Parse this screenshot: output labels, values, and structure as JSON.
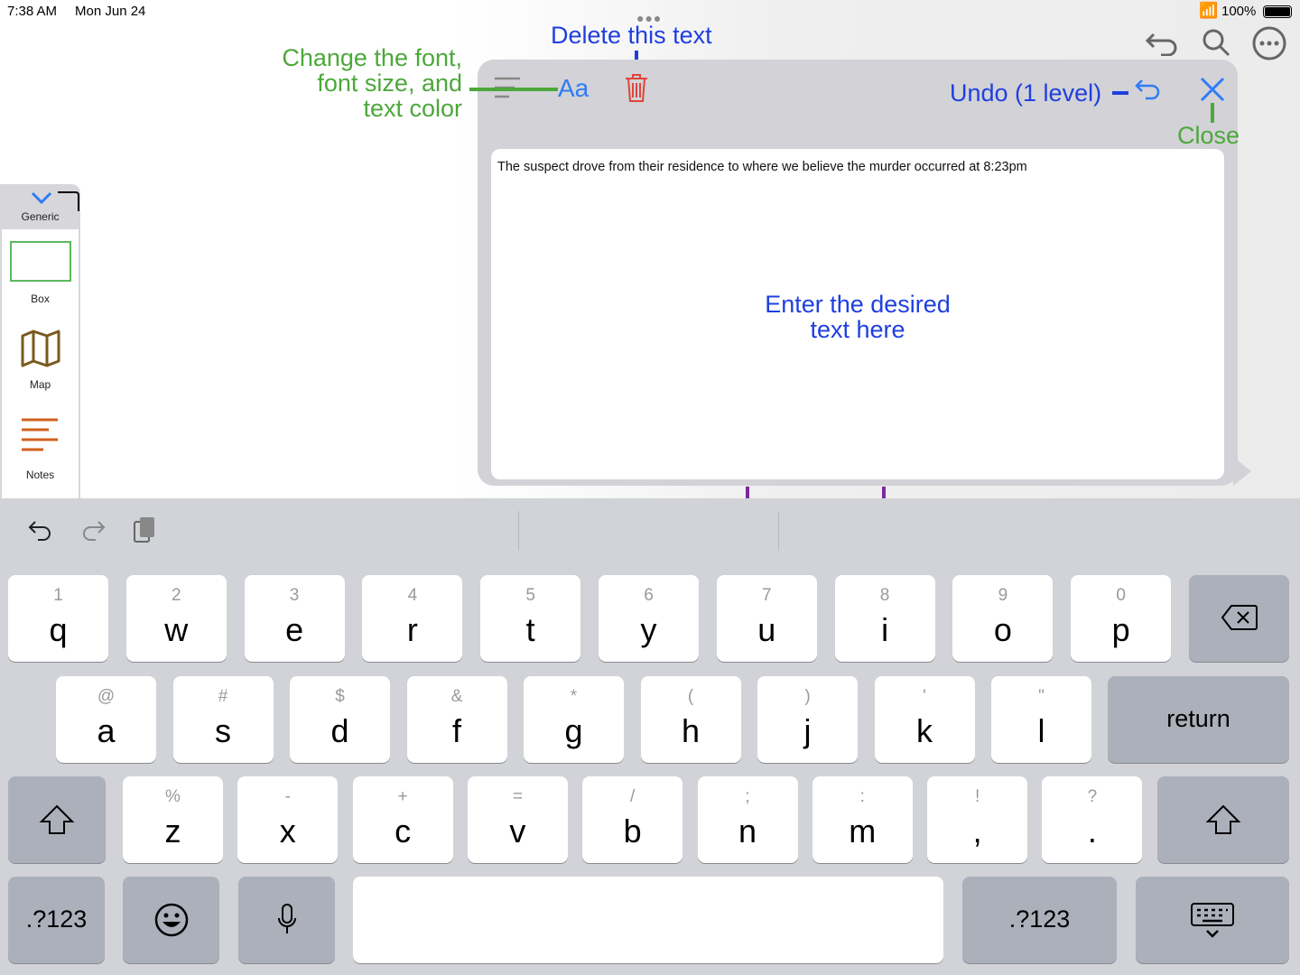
{
  "status_bar": {
    "time": "7:38 AM",
    "date": "Mon Jun 24",
    "battery": "100%"
  },
  "annotations": {
    "delete": "Delete this text",
    "font": [
      "Change the font,",
      "font size, and",
      "text color"
    ],
    "undo": "Undo (1 level)",
    "close": "Close",
    "enter": [
      "Enter the desired",
      "text here"
    ]
  },
  "toolbar": {
    "font_button": "Aa"
  },
  "editor": {
    "text": "The suspect drove from their residence to where we believe the murder occurred at 8:23pm"
  },
  "sidebar": {
    "header": "Generic",
    "items": [
      {
        "label": "Box"
      },
      {
        "label": "Map"
      },
      {
        "label": "Notes"
      }
    ]
  },
  "colors": {
    "annotation_blue": "#1f3fe0",
    "annotation_green": "#4ca83a",
    "accent": "#2f7cf6",
    "delete_red": "#e0453a"
  },
  "keyboard": {
    "row1": [
      {
        "p": "q",
        "s": "1"
      },
      {
        "p": "w",
        "s": "2"
      },
      {
        "p": "e",
        "s": "3"
      },
      {
        "p": "r",
        "s": "4"
      },
      {
        "p": "t",
        "s": "5"
      },
      {
        "p": "y",
        "s": "6"
      },
      {
        "p": "u",
        "s": "7"
      },
      {
        "p": "i",
        "s": "8"
      },
      {
        "p": "o",
        "s": "9"
      },
      {
        "p": "p",
        "s": "0"
      }
    ],
    "row2": [
      {
        "p": "a",
        "s": "@"
      },
      {
        "p": "s",
        "s": "#"
      },
      {
        "p": "d",
        "s": "$"
      },
      {
        "p": "f",
        "s": "&"
      },
      {
        "p": "g",
        "s": "*"
      },
      {
        "p": "h",
        "s": "("
      },
      {
        "p": "j",
        "s": ")"
      },
      {
        "p": "k",
        "s": "'"
      },
      {
        "p": "l",
        "s": "\""
      }
    ],
    "row3": [
      {
        "p": "z",
        "s": "%"
      },
      {
        "p": "x",
        "s": "-"
      },
      {
        "p": "c",
        "s": "+"
      },
      {
        "p": "v",
        "s": "="
      },
      {
        "p": "b",
        "s": "/"
      },
      {
        "p": "n",
        "s": ";"
      },
      {
        "p": "m",
        "s": ":"
      },
      {
        "p": ",",
        "s": "!"
      },
      {
        "p": ".",
        "s": "?"
      }
    ],
    "return": "return",
    "numbers": ".?123"
  }
}
